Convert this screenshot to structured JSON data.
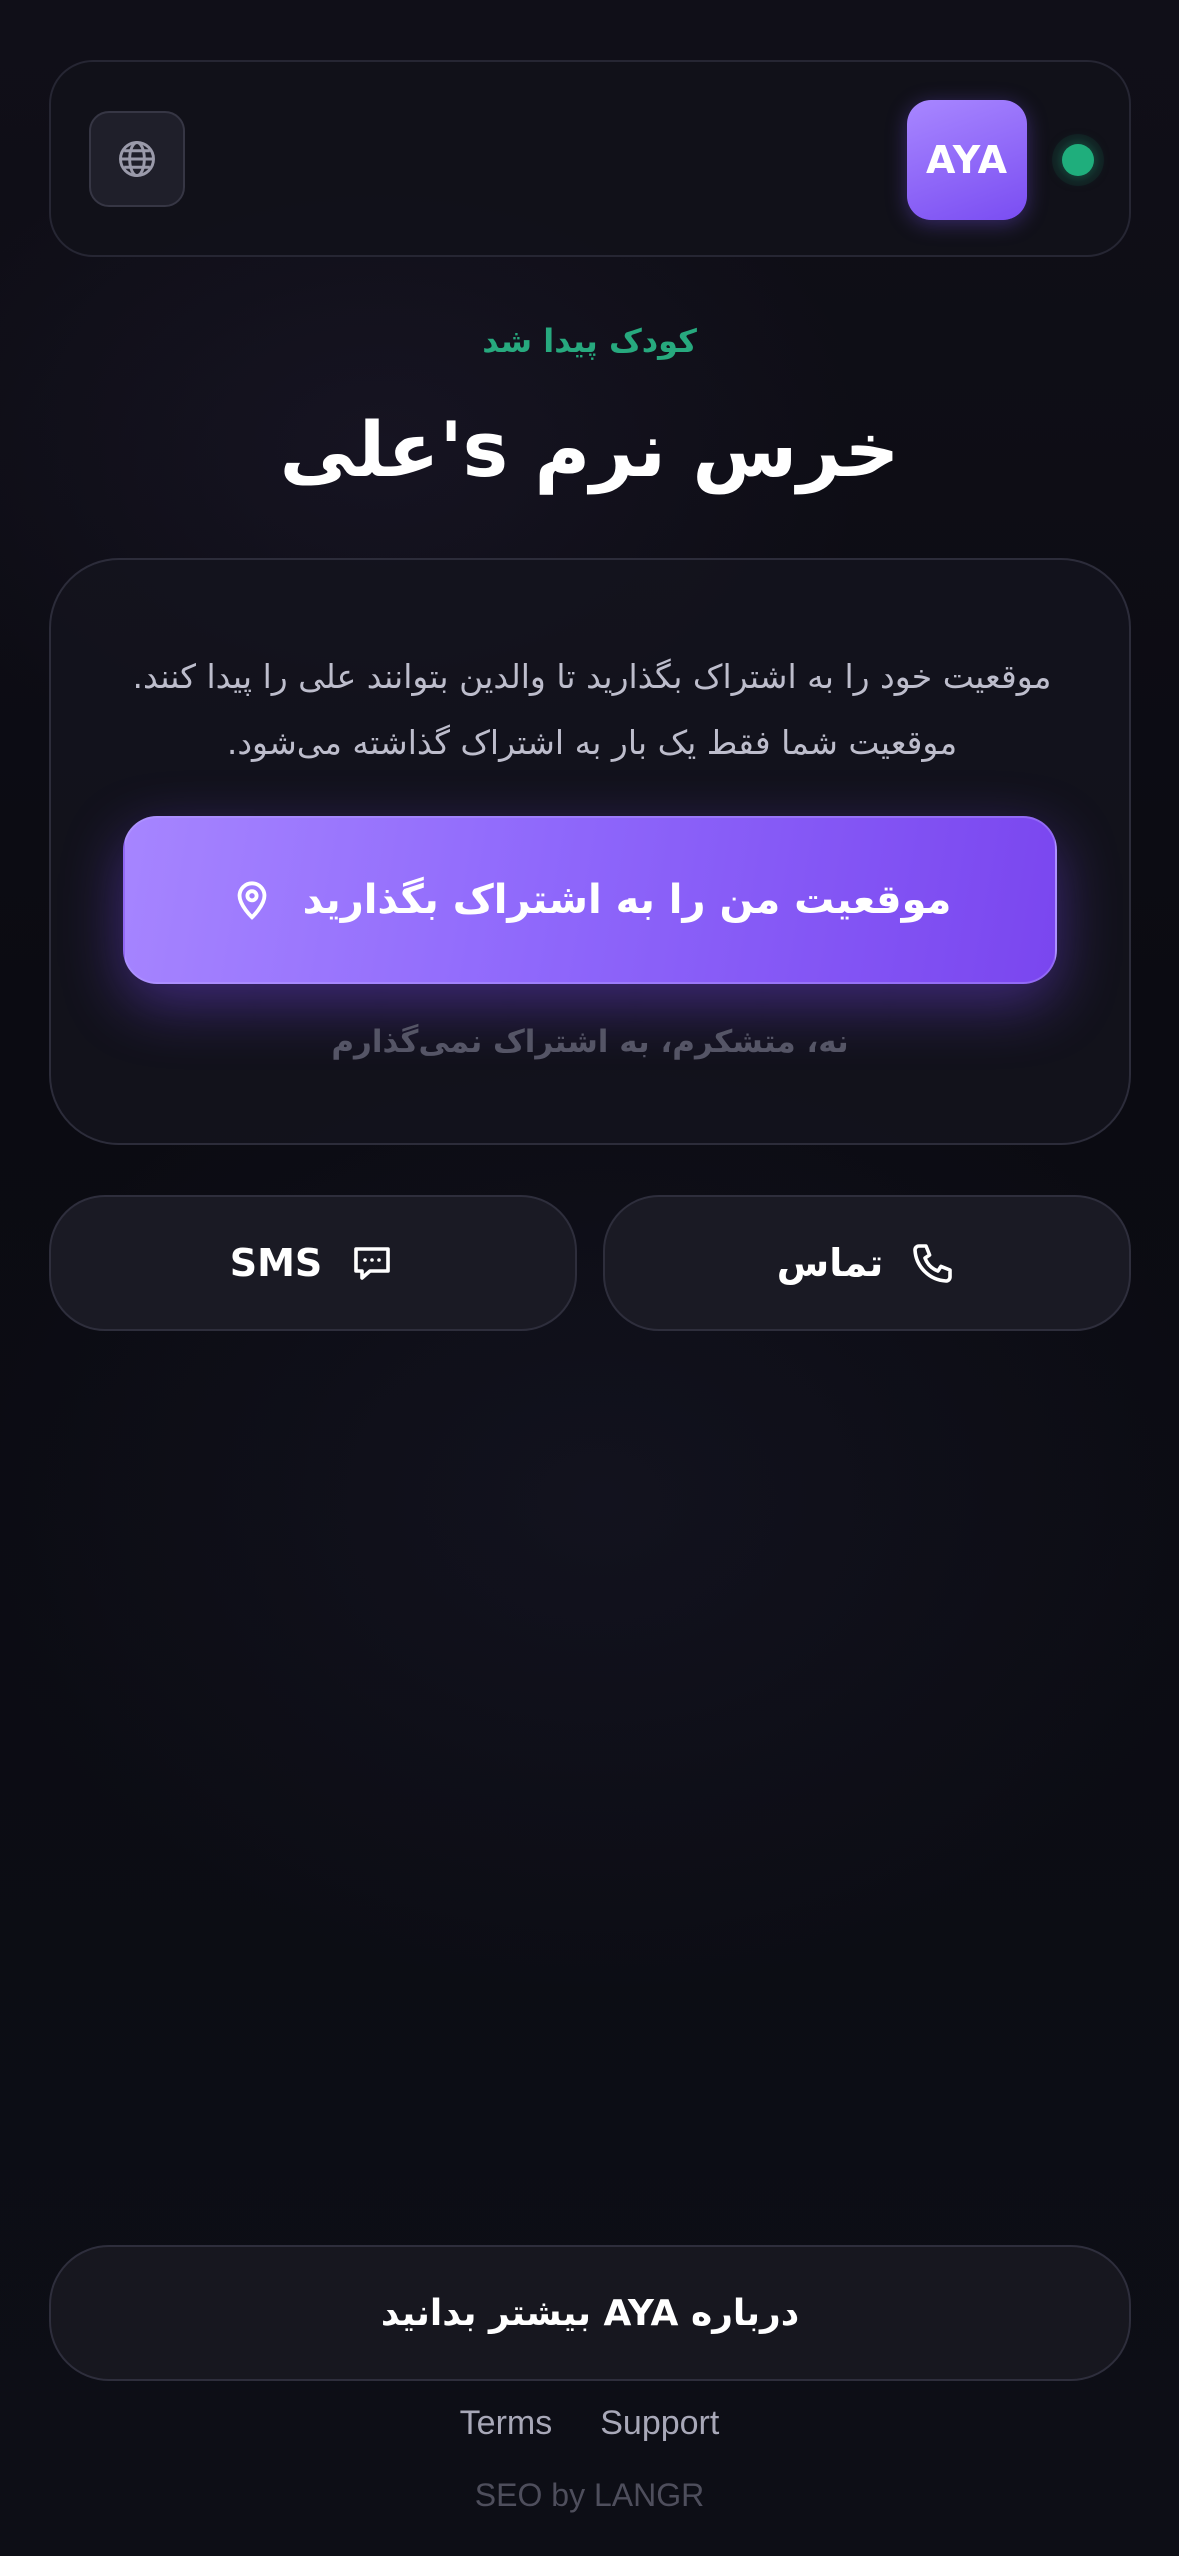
{
  "header": {
    "language_icon": "globe-icon",
    "logo_text": "AYA",
    "status_color": "#1fae7c"
  },
  "hero": {
    "found_label": "کودک پیدا شد",
    "title": "علی's خرس نرم"
  },
  "card": {
    "description": "موقعیت خود را به اشتراک بگذارید تا والدین بتوانند علی را پیدا کنند. موقعیت شما فقط یک بار به اشتراک گذاشته می‌شود.",
    "share_button": {
      "label": "موقعیت من را به اشتراک بگذارید",
      "icon": "location-pin-icon"
    },
    "decline_label": "نه، متشکرم، به اشتراک نمی‌گذارم"
  },
  "actions": {
    "sms": {
      "label": "SMS",
      "icon": "chat-bubble-icon"
    },
    "call": {
      "label": "تماس",
      "icon": "phone-icon"
    }
  },
  "footer": {
    "learn_more": "درباره AYA بیشتر بدانید",
    "links": [
      "Terms",
      "Support"
    ],
    "credit": "SEO by LANGR"
  },
  "colors": {
    "accent_start": "#a685ff",
    "accent_end": "#7a46ef",
    "success": "#27a97e",
    "background": "#0c0c14"
  }
}
